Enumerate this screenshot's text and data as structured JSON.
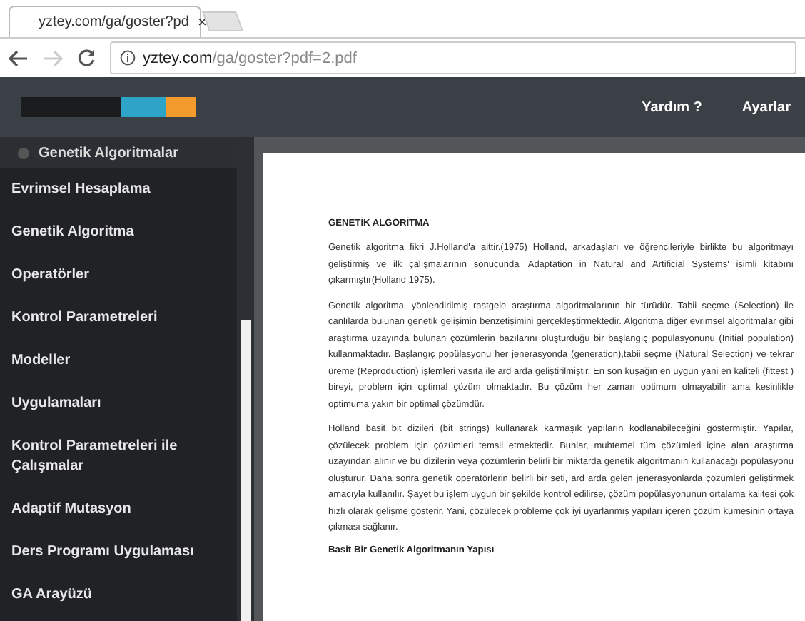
{
  "browser": {
    "tab": {
      "title": "yztey.com/ga/goster?pd",
      "close": "×"
    },
    "address": {
      "host": "yztey.com",
      "path": "/ga/goster?pdf=2.pdf"
    }
  },
  "header": {
    "links": [
      "Yardım ?",
      "Ayarlar"
    ]
  },
  "sidebar": {
    "title": "Genetik Algoritmalar",
    "items": [
      {
        "label": "Evrimsel Hesaplama"
      },
      {
        "label": "Genetik Algoritma"
      },
      {
        "label": "Operatörler"
      },
      {
        "label": "Kontrol Parametreleri"
      },
      {
        "label": "Modeller"
      },
      {
        "label": "Uygulamaları"
      },
      {
        "label": "Kontrol Parametreleri ile Çalışmalar"
      },
      {
        "label": "Adaptif Mutasyon"
      },
      {
        "label": "Ders Programı Uygulaması"
      },
      {
        "label": "GA Arayüzü"
      }
    ]
  },
  "document": {
    "blocks": [
      {
        "kind": "heading",
        "text": "GENETİK ALGORİTMA"
      },
      {
        "kind": "paragraph",
        "text": "Genetik algoritma fikri J.Holland'a aittir.(1975) Holland, arkadaşları ve öğrencileriyle birlikte bu algoritmayı geliştirmiş ve ilk çalışmalarının sonucunda 'Adaptation in Natural and Artificial Systems' isimli kitabını çıkarmıştır(Holland 1975)."
      },
      {
        "kind": "paragraph",
        "text": "Genetik algoritma, yönlendirilmiş rastgele araştırma algoritmalarının bir türüdür. Tabii seçme (Selection) ile canlılarda bulunan genetik gelişimin benzetişimini gerçekleştirmektedir. Algoritma diğer evrimsel algoritmalar gibi araştırma uzayında bulunan çözümlerin bazılarını oluşturduğu bir başlangıç popülasyonunu (Initial population) kullanmaktadır. Başlangıç popülasyonu her jenerasyonda (generation),tabii seçme (Natural Selection) ve tekrar üreme (Reproduction) işlemleri vasıta ile ard arda geliştirilmiştir. En son kuşağın en uygun yani en kaliteli (fittest ) bireyi, problem için optimal çözüm olmaktadır. Bu çözüm her zaman optimum olmayabilir ama kesinlikle optimuma yakın bir optimal çözümdür."
      },
      {
        "kind": "paragraph",
        "text": "Holland basit bit dizileri (bit strings) kullanarak karmaşık yapıların kodlanabileceğini göstermiştir. Yapılar, çözülecek problem için çözümleri temsil etmektedir. Bunlar, muhtemel tüm çözümleri içine alan araştırma uzayından alınır ve bu dizilerin veya çözümlerin belirli bir miktarda genetik algoritmanın kullanacağı popülasyonu oluşturur. Daha sonra genetik operatörlerin belirli bir seti, ard arda gelen jenerasyonlarda çözümleri geliştirmek amacıyla kullanılır. Şayet bu işlem uygun bir şekilde kontrol edilirse, çözüm popülasyonunun ortalama kalitesi çok hızlı olarak gelişme gösterir. Yani, çözülecek probleme çok iyi uyarlanmış yapıları içeren çözüm kümesinin ortaya çıkması sağlanır."
      },
      {
        "kind": "heading",
        "text": "Basit Bir Genetik Algoritmanın Yapısı"
      }
    ]
  }
}
